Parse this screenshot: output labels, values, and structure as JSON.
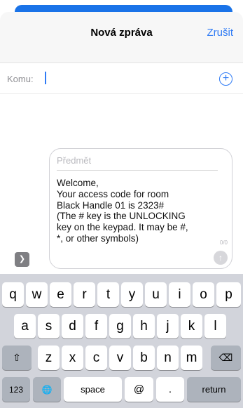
{
  "header": {
    "title": "Nová zpráva",
    "cancel_label": "Zrušit"
  },
  "recipient": {
    "label": "Komu:",
    "add_icon": "+"
  },
  "compose": {
    "subject_placeholder": "Předmět",
    "message_lines": [
      "Welcome,",
      "Your access code for room",
      "Black Handle 01 is 2323#",
      "(The # key is the UNLOCKING",
      "key on the keypad. It may be #,",
      "*, or other symbols)"
    ],
    "counter": "0/0",
    "send_icon": "↑"
  },
  "apps_icon": "❯",
  "keyboard": {
    "row1": [
      "q",
      "w",
      "e",
      "r",
      "t",
      "y",
      "u",
      "i",
      "o",
      "p"
    ],
    "row2": [
      "a",
      "s",
      "d",
      "f",
      "g",
      "h",
      "j",
      "k",
      "l"
    ],
    "row3": [
      "z",
      "x",
      "c",
      "v",
      "b",
      "n",
      "m"
    ],
    "shift_icon": "⇧",
    "delete_icon": "⌫",
    "numbers_label": "123",
    "globe_icon": "🌐",
    "space_label": "space",
    "at_label": "@",
    "dot_label": ".",
    "return_label": "return"
  }
}
